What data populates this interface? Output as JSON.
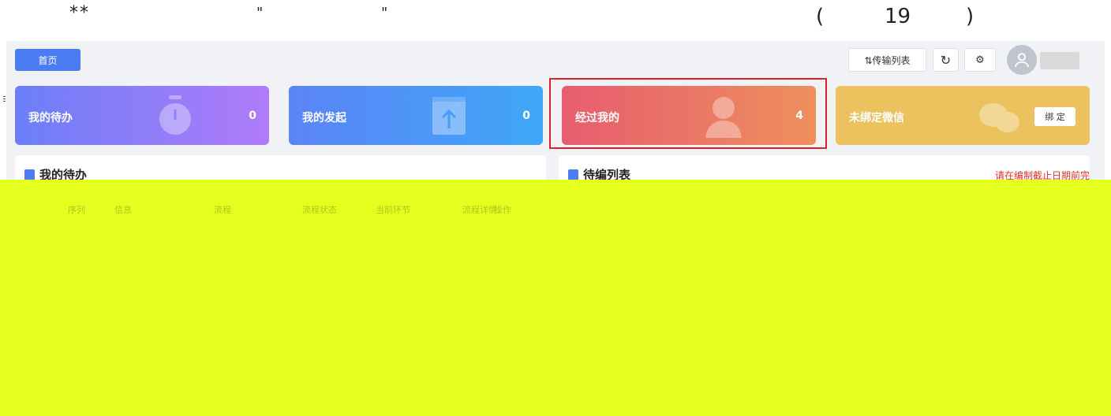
{
  "doc": {
    "stars": "**",
    "quote_open": "\"",
    "quote_close": "\"",
    "paren_open": "(",
    "number": "19",
    "paren_close": ")"
  },
  "topbar": {
    "home_tab": "首页",
    "transfer_button": "⇅传输列表",
    "refresh_icon": "refresh-icon",
    "settings_icon": "gear-icon"
  },
  "cards": [
    {
      "label": "我的待办",
      "count": "0",
      "icon": "clock-icon"
    },
    {
      "label": "我的发起",
      "count": "0",
      "icon": "upload-icon"
    },
    {
      "label": "经过我的",
      "count": "4",
      "icon": "user-icon"
    },
    {
      "label": "未绑定微信",
      "button": "绑 定",
      "icon": "wechat-icon"
    }
  ],
  "panels": {
    "left_title": "我的待办",
    "right_title": "待编列表",
    "notice": "请在编制截止日期前完"
  },
  "table_headers": [
    "序列",
    "信息",
    "流程",
    "流程状态",
    "当前环节",
    "流程详情",
    "操作"
  ],
  "colors": {
    "primary": "#4c7cf3",
    "overlay": "#e5ff1f",
    "highlight": "#e02020"
  }
}
